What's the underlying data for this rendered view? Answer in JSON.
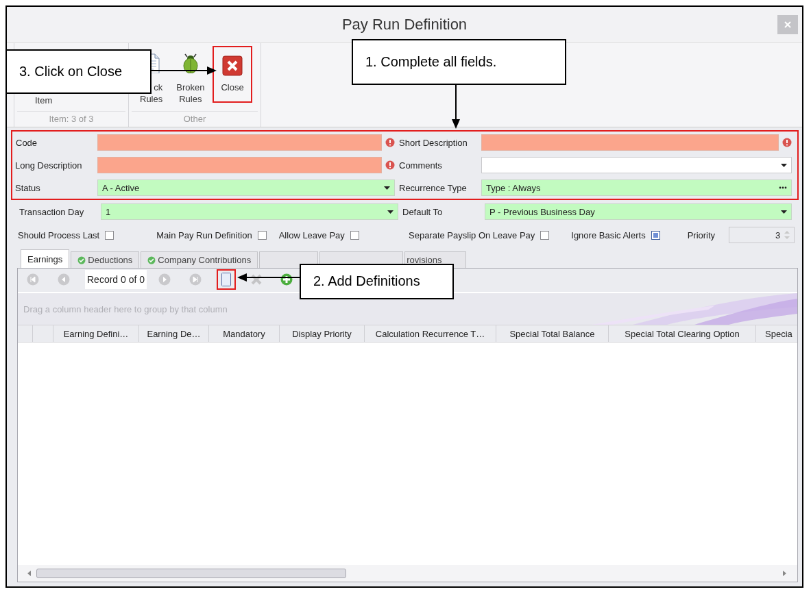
{
  "window": {
    "title": "Pay Run Definition"
  },
  "ribbon": {
    "groups": [
      {
        "caption": "Item: 3 of 3",
        "buttons": [
          {
            "lines": [
              "Item"
            ],
            "kind": "plain",
            "highlighted": false
          }
        ]
      },
      {
        "caption": "Other",
        "buttons": [
          {
            "lines": [
              "ck",
              "Rules"
            ],
            "kind": "rules",
            "highlighted": false
          },
          {
            "lines": [
              "Broken",
              "Rules"
            ],
            "kind": "broken",
            "highlighted": false
          },
          {
            "lines": [
              "Close"
            ],
            "kind": "close",
            "highlighted": true
          }
        ]
      }
    ]
  },
  "form": {
    "sections": [
      {
        "highlighted": true,
        "rows": [
          [
            {
              "label": "Code",
              "kind": "text",
              "invalid": true
            },
            {
              "label": "Short Description",
              "kind": "text",
              "invalid": true
            }
          ],
          [
            {
              "label": "Long Description",
              "kind": "text",
              "invalid": true
            },
            {
              "label": "Comments",
              "kind": "dropdown",
              "invalid": false,
              "required": false
            }
          ],
          [
            {
              "label": "Status",
              "kind": "dropdown",
              "invalid": false,
              "required": true,
              "value": "A - Active"
            },
            {
              "label": "Recurrence Type",
              "kind": "ellipsis",
              "invalid": false,
              "required": true,
              "value": "Type : Always"
            }
          ]
        ]
      },
      {
        "rows": [
          [
            {
              "label": "Transaction Day",
              "kind": "dropdown",
              "invalid": false,
              "required": true,
              "value": "1"
            },
            {
              "label": "Default To",
              "kind": "dropdown",
              "invalid": false,
              "required": true,
              "value": "P - Previous Business Day"
            }
          ]
        ]
      }
    ],
    "options_left": [
      {
        "label": "Should Process Last",
        "checked": false
      },
      {
        "label": "Main Pay Run Definition",
        "checked": false
      },
      {
        "label": "Allow Leave Pay",
        "checked": false
      }
    ],
    "options_right": [
      {
        "label": "Separate Payslip On Leave Pay",
        "checked": false
      },
      {
        "label": "Ignore Basic Alerts",
        "checked": true
      }
    ],
    "priority": {
      "label": "Priority",
      "value": "3"
    }
  },
  "tabs": [
    {
      "label": "Earnings",
      "selected": true,
      "check": false
    },
    {
      "label": "Deductions",
      "selected": false,
      "check": true
    },
    {
      "label": "Company Contributions",
      "selected": false,
      "check": true
    },
    {
      "selected": false,
      "check": false
    },
    {
      "selected": false,
      "check": false
    },
    {
      "label": "rovisions",
      "selected": false,
      "check": false
    }
  ],
  "navigator": [
    {
      "kind": "first"
    },
    {
      "kind": "prev"
    },
    {
      "kind": "record",
      "text": "Record 0 of 0"
    },
    {
      "kind": "next"
    },
    {
      "kind": "last"
    },
    {
      "kind": "new",
      "highlighted": true
    },
    {
      "kind": "delete",
      "highlighted": false
    },
    {
      "kind": "add",
      "highlighted": false
    }
  ],
  "grid": {
    "group_panel": "Drag a column header here to group by that column",
    "columns": [
      "Earning Defini…",
      "Earning De…",
      "Mandatory",
      "Display Priority",
      "Calculation Recurrence T…",
      "Special Total Balance",
      "Special Total Clearing Option",
      "Specia"
    ]
  },
  "callouts": [
    {
      "kind": "close",
      "text": "3. Click on Close"
    },
    {
      "kind": "fields",
      "text": "1. Complete all fields."
    },
    {
      "kind": "add",
      "text": "2. Add Definitions"
    }
  ]
}
